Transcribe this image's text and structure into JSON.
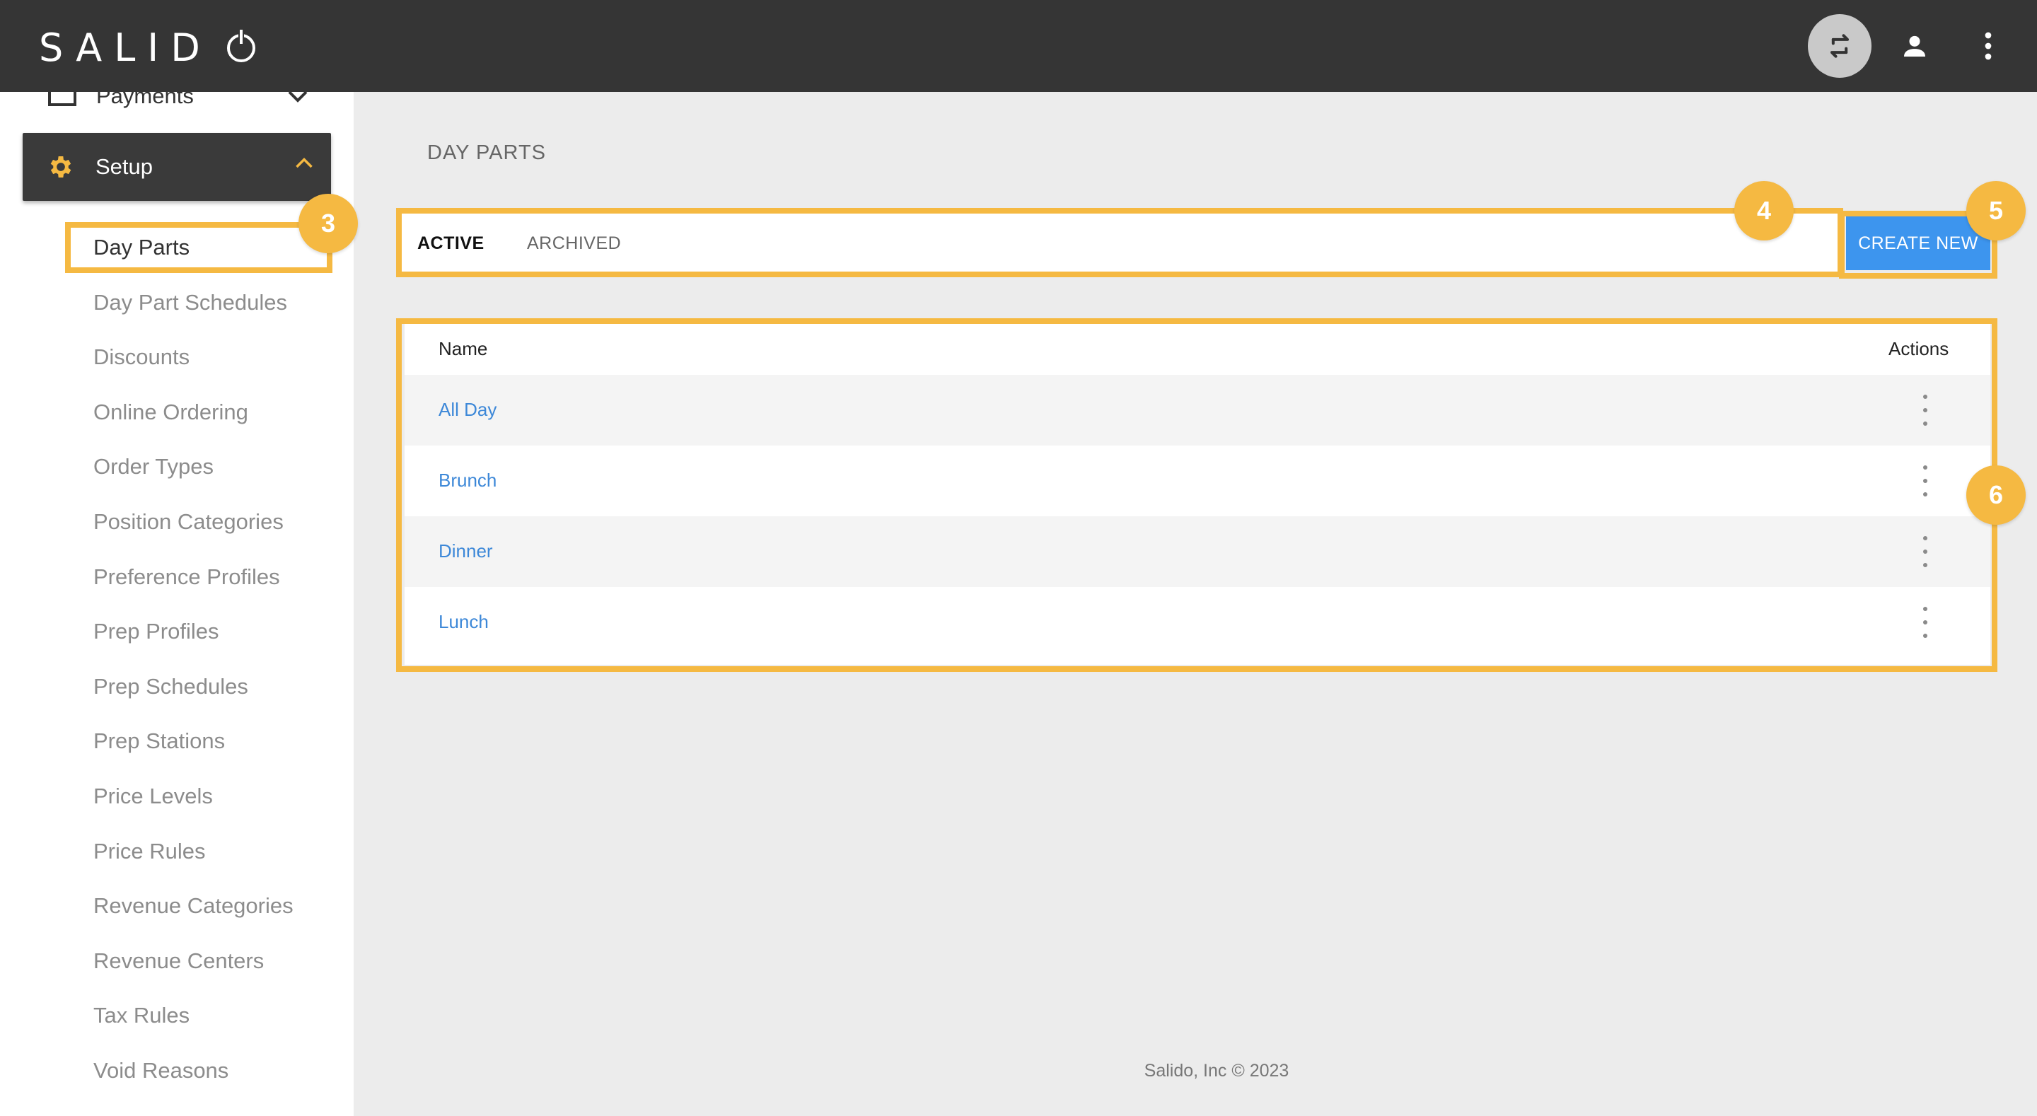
{
  "topbar": {
    "logo_text": "SALID",
    "icons": [
      "swap-icon",
      "user-icon",
      "more-vertical-icon"
    ]
  },
  "sidebar": {
    "payments_label": "Payments",
    "setup_label": "Setup",
    "setup_items": [
      "Day Parts",
      "Day Part Schedules",
      "Discounts",
      "Online Ordering",
      "Order Types",
      "Position Categories",
      "Preference Profiles",
      "Prep Profiles",
      "Prep Schedules",
      "Prep Stations",
      "Price Levels",
      "Price Rules",
      "Revenue Categories",
      "Revenue Centers",
      "Tax Rules",
      "Void Reasons"
    ],
    "active_item": "Day Parts"
  },
  "main": {
    "title": "DAY PARTS",
    "tabs": {
      "active": "ACTIVE",
      "archived": "ARCHIVED"
    },
    "create_button": "CREATE NEW",
    "table": {
      "headers": {
        "name": "Name",
        "actions": "Actions"
      },
      "rows": [
        "All Day",
        "Brunch",
        "Dinner",
        "Lunch"
      ]
    }
  },
  "annotations": {
    "badge_3": "3",
    "badge_4": "4",
    "badge_5": "5",
    "badge_6": "6"
  },
  "colors": {
    "topbar": "#353535",
    "accent": "#f5b942",
    "primary": "#3d95ee",
    "link": "#3d88d8"
  },
  "footer": "Salido, Inc © 2023"
}
